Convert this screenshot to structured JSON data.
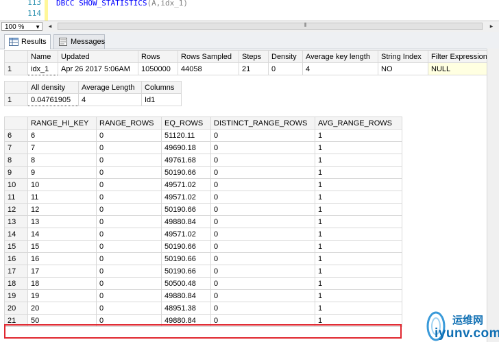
{
  "editor": {
    "line_numbers": [
      "113",
      "114"
    ],
    "code_keyword": "DBCC SHOW_STATISTICS",
    "code_args": "(A,idx_1)"
  },
  "toolbar": {
    "zoom": "100 %"
  },
  "tabs": [
    {
      "label": "Results",
      "icon": "grid-icon",
      "active": true
    },
    {
      "label": "Messages",
      "icon": "messages-icon",
      "active": false
    }
  ],
  "header_grid": {
    "columns": [
      "Name",
      "Updated",
      "Rows",
      "Rows Sampled",
      "Steps",
      "Density",
      "Average key length",
      "String Index",
      "Filter Expression"
    ],
    "rows": [
      [
        "1",
        "idx_1",
        "Apr 26 2017  5:06AM",
        "1050000",
        "44058",
        "21",
        "0",
        "4",
        "NO",
        "NULL"
      ]
    ]
  },
  "density_grid": {
    "columns": [
      "All density",
      "Average Length",
      "Columns"
    ],
    "rows": [
      [
        "1",
        "0.04761905",
        "4",
        "Id1"
      ]
    ]
  },
  "histogram_grid": {
    "columns": [
      "RANGE_HI_KEY",
      "RANGE_ROWS",
      "EQ_ROWS",
      "DISTINCT_RANGE_ROWS",
      "AVG_RANGE_ROWS"
    ],
    "rows": [
      [
        "6",
        "6",
        "0",
        "51120.11",
        "0",
        "1"
      ],
      [
        "7",
        "7",
        "0",
        "49690.18",
        "0",
        "1"
      ],
      [
        "8",
        "8",
        "0",
        "49761.68",
        "0",
        "1"
      ],
      [
        "9",
        "9",
        "0",
        "50190.66",
        "0",
        "1"
      ],
      [
        "10",
        "10",
        "0",
        "49571.02",
        "0",
        "1"
      ],
      [
        "11",
        "11",
        "0",
        "49571.02",
        "0",
        "1"
      ],
      [
        "12",
        "12",
        "0",
        "50190.66",
        "0",
        "1"
      ],
      [
        "13",
        "13",
        "0",
        "49880.84",
        "0",
        "1"
      ],
      [
        "14",
        "14",
        "0",
        "49571.02",
        "0",
        "1"
      ],
      [
        "15",
        "15",
        "0",
        "50190.66",
        "0",
        "1"
      ],
      [
        "16",
        "16",
        "0",
        "50190.66",
        "0",
        "1"
      ],
      [
        "17",
        "17",
        "0",
        "50190.66",
        "0",
        "1"
      ],
      [
        "18",
        "18",
        "0",
        "50500.48",
        "0",
        "1"
      ],
      [
        "19",
        "19",
        "0",
        "49880.84",
        "0",
        "1"
      ],
      [
        "20",
        "20",
        "0",
        "48951.38",
        "0",
        "1"
      ],
      [
        "21",
        "50",
        "0",
        "49880.84",
        "0",
        "1"
      ]
    ]
  },
  "watermark": {
    "brand": "运维网",
    "url": "iyunv.com"
  },
  "colors": {
    "highlight": "#e0262e",
    "keyword": "#0000ff",
    "line_number": "#2b91af"
  }
}
